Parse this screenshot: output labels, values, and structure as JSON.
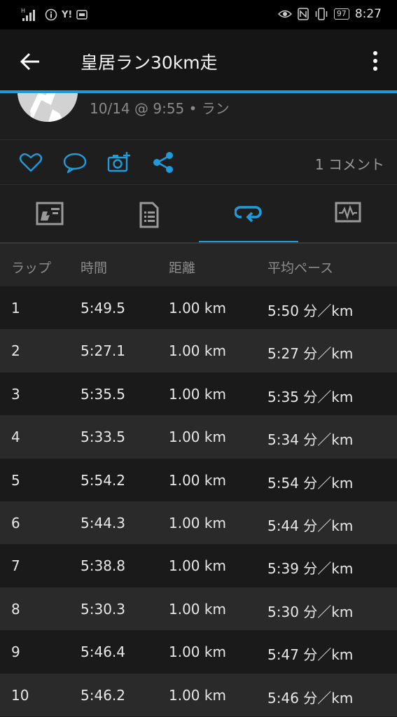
{
  "status_bar": {
    "time": "8:27",
    "battery": "97",
    "left_icons": [
      "signal-icon",
      "info-icon",
      "yahoo-icon",
      "app-icon"
    ],
    "right_icons": [
      "eye-icon",
      "nfc-icon",
      "vibrate-icon",
      "battery-icon"
    ],
    "yahoo_label": "Y!"
  },
  "app_bar": {
    "title": "皇居ラン30km走"
  },
  "activity": {
    "meta": "10/14 @ 9:55 • ラン"
  },
  "actions": {
    "comment_count": "1 コメント"
  },
  "tabs": [
    {
      "icon": "stats-icon"
    },
    {
      "icon": "details-icon"
    },
    {
      "icon": "laps-icon",
      "active": true
    },
    {
      "icon": "charts-icon"
    }
  ],
  "table": {
    "headers": [
      "ラップ",
      "時間",
      "距離",
      "平均ペース"
    ],
    "rows": [
      [
        "1",
        "5:49.5",
        "1.00 km",
        "5:50 分／km"
      ],
      [
        "2",
        "5:27.1",
        "1.00 km",
        "5:27 分／km"
      ],
      [
        "3",
        "5:35.5",
        "1.00 km",
        "5:35 分／km"
      ],
      [
        "4",
        "5:33.5",
        "1.00 km",
        "5:34 分／km"
      ],
      [
        "5",
        "5:54.2",
        "1.00 km",
        "5:54 分／km"
      ],
      [
        "6",
        "5:44.3",
        "1.00 km",
        "5:44 分／km"
      ],
      [
        "7",
        "5:38.8",
        "1.00 km",
        "5:39 分／km"
      ],
      [
        "8",
        "5:30.3",
        "1.00 km",
        "5:30 分／km"
      ],
      [
        "9",
        "5:46.4",
        "1.00 km",
        "5:47 分／km"
      ],
      [
        "10",
        "5:46.2",
        "1.00 km",
        "5:46 分／km"
      ]
    ]
  },
  "colors": {
    "accent": "#1e9bd8",
    "background": "#1c1c1c"
  }
}
